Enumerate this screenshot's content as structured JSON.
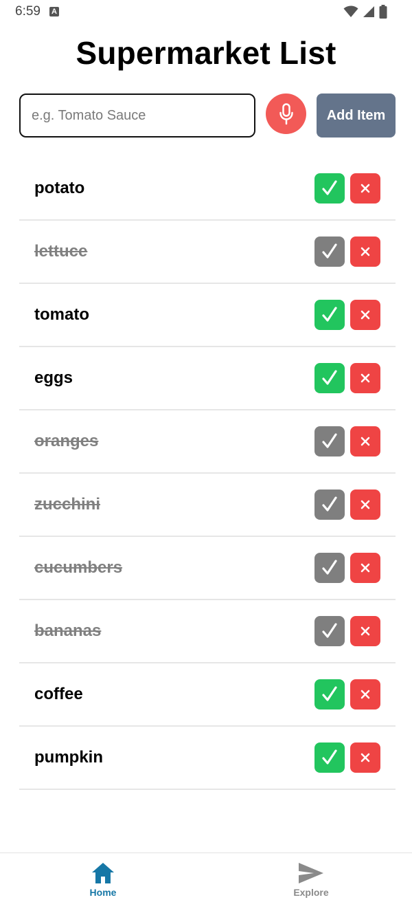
{
  "status_bar": {
    "time": "6:59",
    "notification_icon": "a-letter-icon",
    "icons": [
      "wifi-icon",
      "signal-icon",
      "battery-icon"
    ]
  },
  "header": {
    "title": "Supermarket List"
  },
  "add_form": {
    "input_value": "",
    "input_placeholder": "e.g. Tomato Sauce",
    "mic_icon": "microphone-icon",
    "add_label": "Add Item"
  },
  "items": [
    {
      "label": "potato",
      "done": false
    },
    {
      "label": "lettuce",
      "done": true
    },
    {
      "label": "tomato",
      "done": false
    },
    {
      "label": "eggs",
      "done": false
    },
    {
      "label": "oranges",
      "done": true
    },
    {
      "label": "zucchini",
      "done": true
    },
    {
      "label": "cucumbers",
      "done": true
    },
    {
      "label": "bananas",
      "done": true
    },
    {
      "label": "coffee",
      "done": false
    },
    {
      "label": "pumpkin",
      "done": false
    }
  ],
  "item_actions": {
    "check_icon": "checkmark-icon",
    "delete_icon": "close-icon"
  },
  "bottom_nav": {
    "tabs": [
      {
        "label": "Home",
        "icon": "home-icon",
        "active": true
      },
      {
        "label": "Explore",
        "icon": "send-icon",
        "active": false
      }
    ]
  },
  "colors": {
    "check_active": "#22c55e",
    "check_done": "#7f7f7f",
    "delete": "#ef4444",
    "mic": "#f25a57",
    "add_button": "#64748b",
    "nav_active": "#1677a6",
    "nav_inactive": "#8a8a8a"
  }
}
